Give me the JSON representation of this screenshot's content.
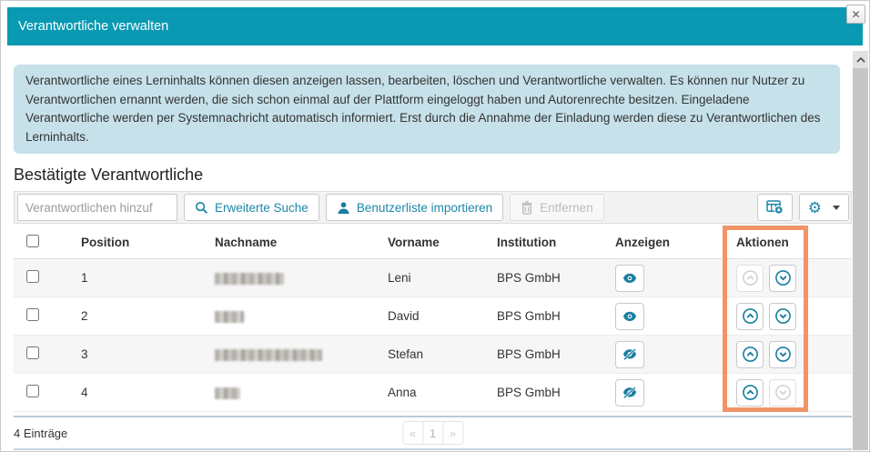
{
  "dialog": {
    "title": "Verantwortliche verwalten"
  },
  "icons": {
    "close": "✕",
    "gear": "⚙"
  },
  "info_text": "Verantwortliche eines Lerninhalts können diesen anzeigen lassen, bearbeiten, löschen und Verantwortliche verwalten. Es können nur Nutzer zu Verantwortlichen ernannt werden, die sich schon einmal auf der Plattform eingeloggt haben und Autorenrechte besitzen. Eingeladene Verantwortliche werden per Systemnachricht automatisch informiert. Erst durch die Annahme der Einladung werden diese zu Verantwortlichen des Lerninhalts.",
  "section_title": "Bestätigte Verantwortliche",
  "toolbar": {
    "add_input_placeholder": "Verantwortlichen hinzuf",
    "advanced_search_label": "Erweiterte Suche",
    "import_label": "Benutzerliste importieren",
    "remove_label": "Entfernen"
  },
  "table": {
    "columns": [
      "Position",
      "Nachname",
      "Vorname",
      "Institution",
      "Anzeigen",
      "Aktionen"
    ],
    "rows": [
      {
        "position": "1",
        "nachname_redacted": true,
        "vorname": "Leni",
        "institution": "BPS GmbH",
        "visibility": "visible",
        "move_up_enabled": false,
        "move_down_enabled": true
      },
      {
        "position": "2",
        "nachname_redacted": true,
        "vorname": "David",
        "institution": "BPS GmbH",
        "visibility": "visible",
        "move_up_enabled": true,
        "move_down_enabled": true
      },
      {
        "position": "3",
        "nachname_redacted": true,
        "vorname": "Stefan",
        "institution": "BPS GmbH",
        "visibility": "hidden",
        "move_up_enabled": true,
        "move_down_enabled": true
      },
      {
        "position": "4",
        "nachname_redacted": true,
        "vorname": "Anna",
        "institution": "BPS GmbH",
        "visibility": "hidden",
        "move_up_enabled": true,
        "move_down_enabled": false
      }
    ]
  },
  "footer": {
    "count_label": "4 Einträge",
    "pagination": [
      "«",
      "1",
      "»"
    ]
  },
  "colors": {
    "header_bg": "#0999b3",
    "info_bg": "#c6e1ea",
    "accent_teal": "#1d87a9",
    "highlight_orange": "#f09467"
  }
}
